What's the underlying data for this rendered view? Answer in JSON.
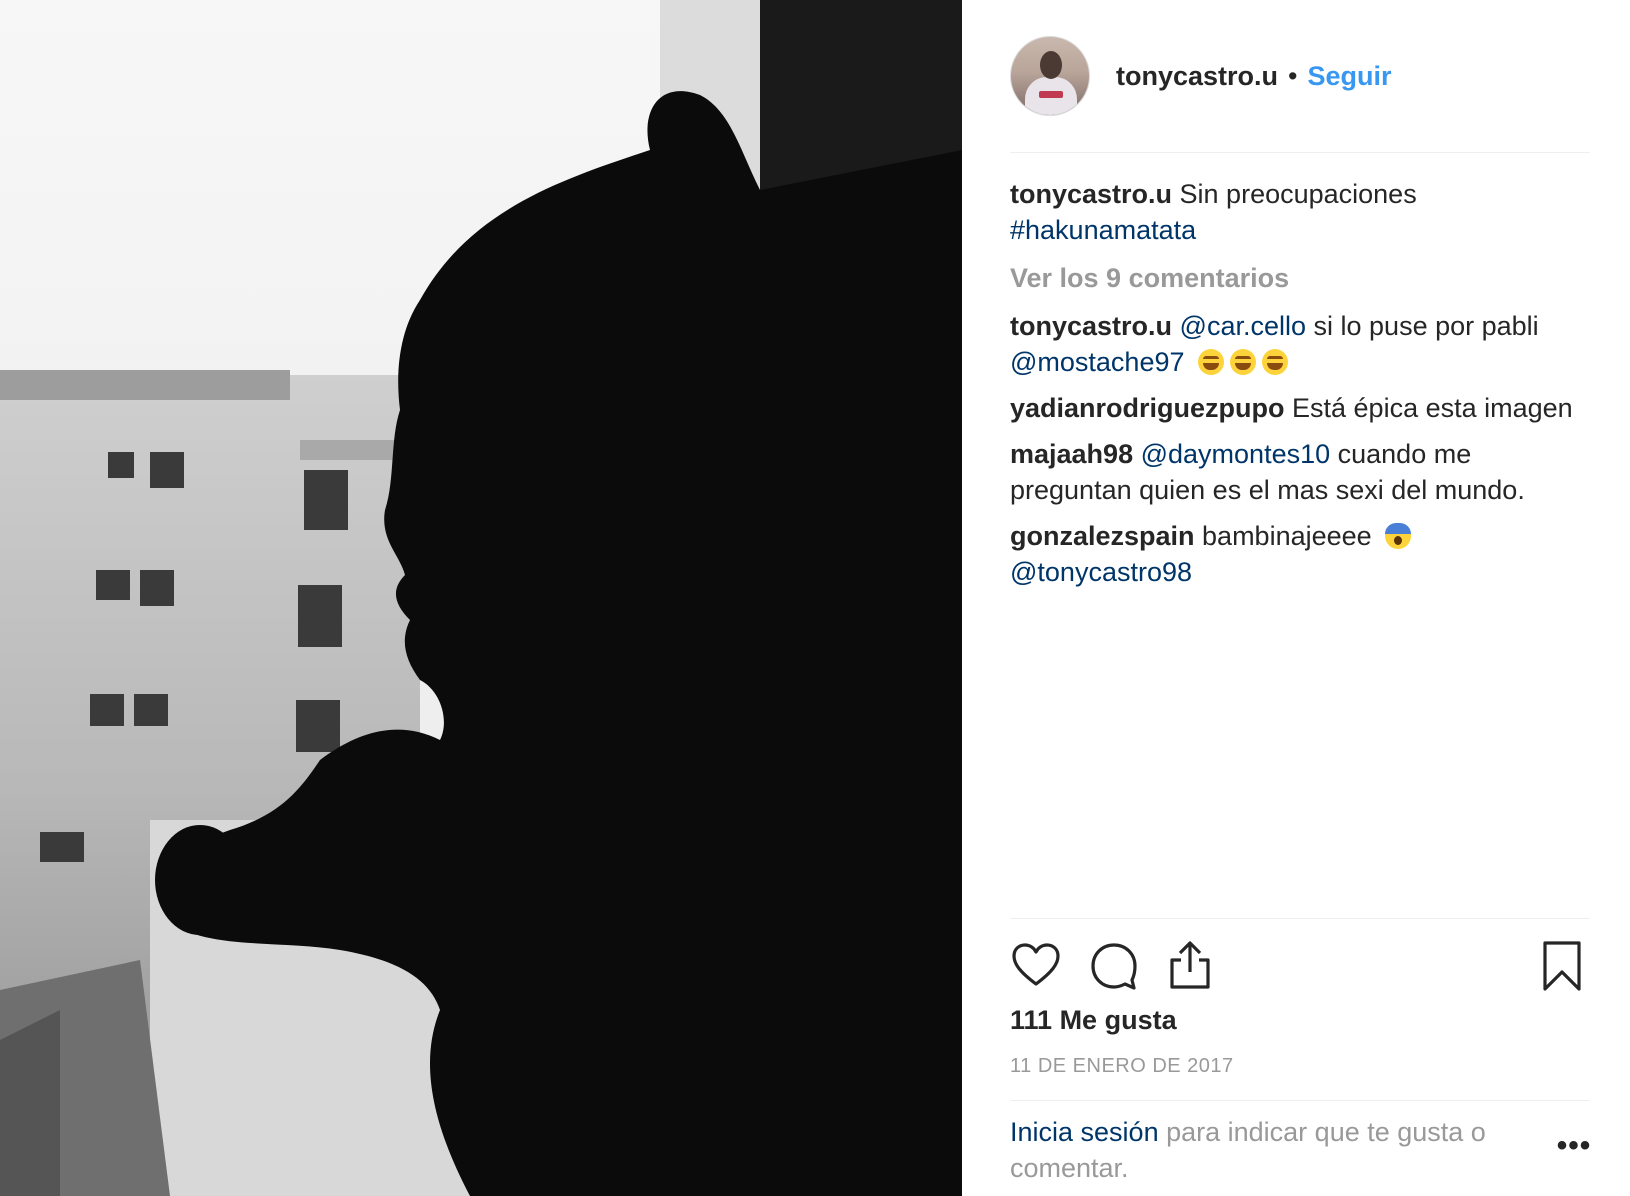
{
  "post": {
    "image_description_icon": "photo-silhouette-man-with-pipe",
    "header": {
      "username": "tonycastro.u",
      "separator": "•",
      "follow_label": "Seguir"
    },
    "caption": {
      "username": "tonycastro.u",
      "text": " Sin preocupaciones",
      "hashtag": "#hakunamatata"
    },
    "view_all_comments": "Ver los 9 comentarios",
    "comments": [
      {
        "username": "tonycastro.u",
        "mention1": "@car.cello",
        "text": " si lo puse por pabli ",
        "mention2": "@mostache97",
        "emoji": "joy-emoji x3"
      },
      {
        "username": "yadianrodriguezpupo",
        "text": " Está épica esta imagen"
      },
      {
        "username": "majaah98",
        "mention1": "@daymontes10",
        "text": " cuando me preguntan quien es el mas sexi del mundo."
      },
      {
        "username": "gonzalezspain",
        "text": " bambinajeeee ",
        "emoji": "fearful-emoji",
        "mention2": "@tonycastro98"
      }
    ],
    "likes": "111 Me gusta",
    "date": "11 DE ENERO DE 2017",
    "login_prompt": {
      "link": "Inicia sesión",
      "text": " para indicar que te gusta o comentar."
    },
    "more_label": "•••"
  },
  "colors": {
    "link_blue": "#003569",
    "follow_blue": "#3897f0",
    "muted": "#999999",
    "text": "#262626",
    "divider": "#efefef"
  }
}
